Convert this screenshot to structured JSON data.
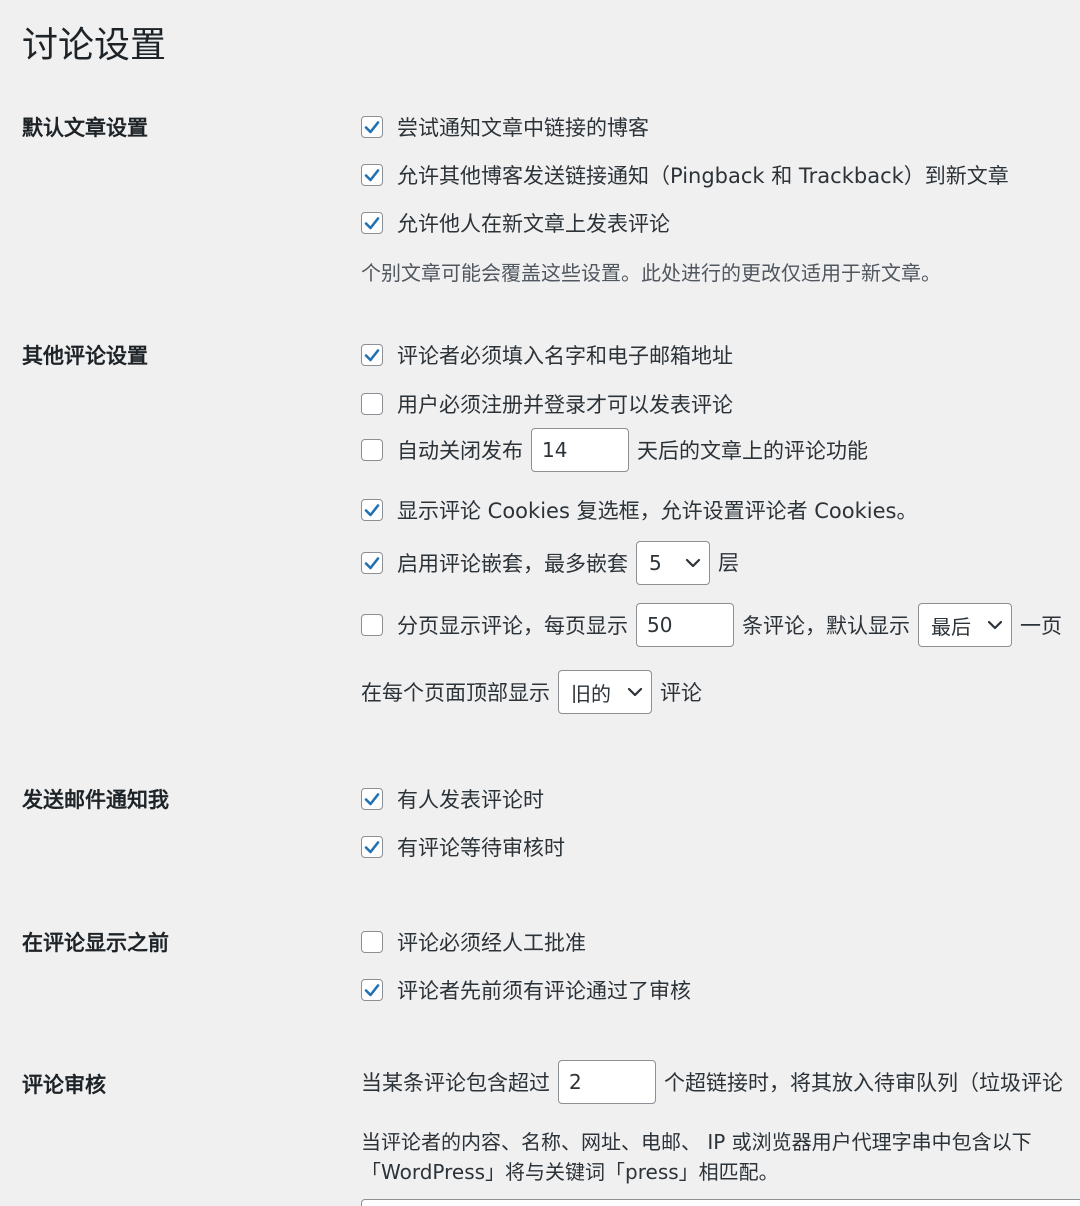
{
  "page_title": "讨论设置",
  "sections": {
    "default_article": {
      "label": "默认文章设置",
      "notify_blogs": "尝试通知文章中链接的博客",
      "allow_pingbacks": "允许其他博客发送链接通知（Pingback 和 Trackback）到新文章",
      "allow_comments": "允许他人在新文章上发表评论",
      "note": "个别文章可能会覆盖这些设置。此处进行的更改仅适用于新文章。"
    },
    "other_comments": {
      "label": "其他评论设置",
      "require_name_email": "评论者必须填入名字和电子邮箱地址",
      "require_registration": "用户必须注册并登录才可以发表评论",
      "auto_close_prefix": "自动关闭发布",
      "auto_close_days": "14",
      "auto_close_suffix": "天后的文章上的评论功能",
      "show_cookies": "显示评论 Cookies 复选框，允许设置评论者 Cookies。",
      "threaded_prefix": "启用评论嵌套，最多嵌套",
      "threaded_depth": "5",
      "threaded_suffix": "层",
      "paged_prefix": "分页显示评论，每页显示",
      "paged_count": "50",
      "paged_middle": "条评论，默认显示",
      "paged_default": "最后",
      "paged_suffix": "一页",
      "order_prefix": "在每个页面顶部显示",
      "order_value": "旧的",
      "order_suffix": "评论"
    },
    "email_me": {
      "label": "发送邮件通知我",
      "anyone_posts": "有人发表评论时",
      "held_moderation": "有评论等待审核时"
    },
    "before_appears": {
      "label": "在评论显示之前",
      "manual_approve": "评论必须经人工批准",
      "previously_approved": "评论者先前须有评论通过了审核"
    },
    "moderation": {
      "label": "评论审核",
      "links_prefix": "当某条评论包含超过",
      "links_count": "2",
      "links_suffix": "个超链接时，将其放入待审队列（垃圾评论",
      "keywords_line1": "当评论者的内容、名称、网址、电邮、 IP 或浏览器用户代理字串中包含以下",
      "keywords_line2": "「WordPress」将与关键词「press」相匹配。"
    }
  },
  "colors": {
    "checkmark": "#2271b1",
    "border": "#8c8f94",
    "background": "#f0f0f1"
  }
}
